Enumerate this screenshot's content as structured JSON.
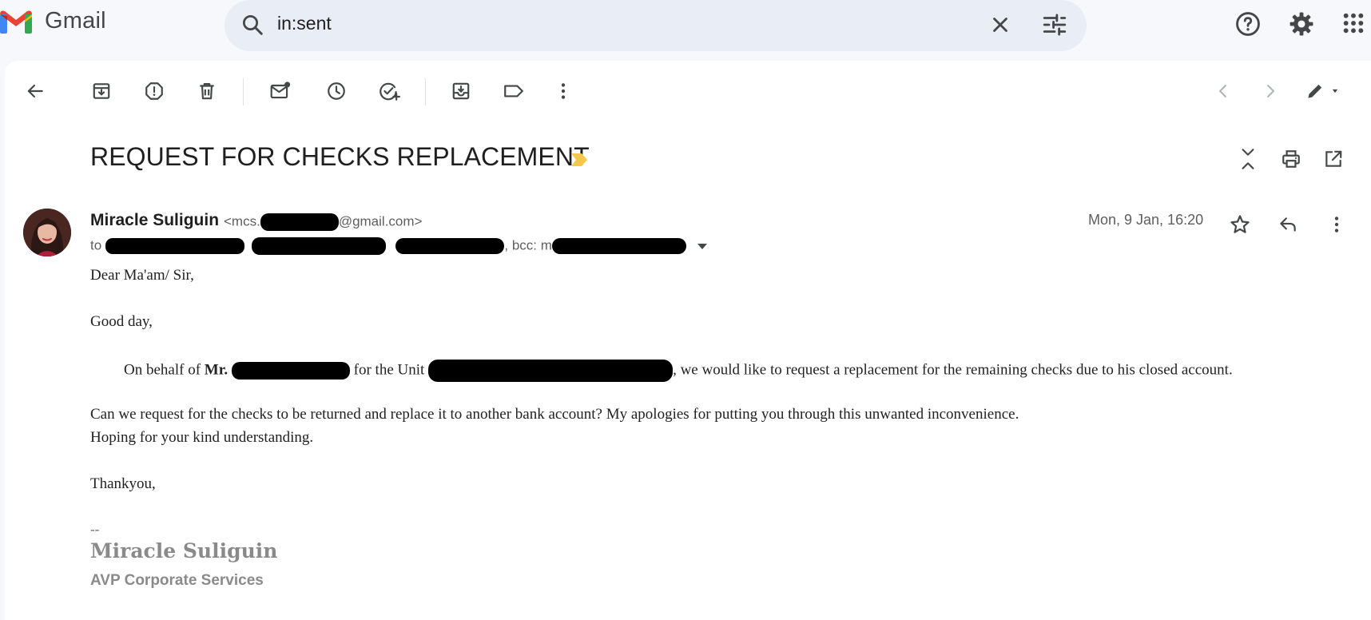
{
  "app": {
    "name": "Gmail"
  },
  "search": {
    "query": "in:sent"
  },
  "toolbar": {
    "icons": [
      "back-arrow-icon",
      "archive-icon",
      "report-spam-icon",
      "delete-icon",
      "mark-unread-icon",
      "snooze-icon",
      "add-to-tasks-icon",
      "move-to-icon",
      "label-icon",
      "more-vert-icon",
      "older-chevron-icon",
      "newer-chevron-icon",
      "pen-icon"
    ]
  },
  "email": {
    "subject": "REQUEST FOR CHECKS REPLACEMENT",
    "sender_name": "Miracle Suliguin",
    "sender_email_prefix": "<mcs.",
    "sender_email_suffix": "@gmail.com>",
    "to_prefix": "to",
    "bcc_label": ", bcc: m",
    "date": "Mon, 9 Jan, 16:20",
    "body": {
      "greeting": "Dear Ma'am/ Sir,",
      "good_day": "Good day,",
      "p1_start": "On behalf of ",
      "p1_mr": "Mr.",
      "p1_mid": " for the Unit ",
      "p1_end": ", we would like to request a replacement for the remaining checks due to his closed account.",
      "p2": "Can we request for the checks to be returned and replace it to another bank account? My apologies for putting you through this unwanted inconvenience.",
      "p3": "Hoping for your kind understanding.",
      "closing": "Thankyou,",
      "sig_sep": "--",
      "sig_name": "Miracle Suliguin",
      "sig_title": "AVP Corporate Services"
    }
  },
  "colors": {
    "background": "#f6f8fc",
    "search_bg": "#e9eef6",
    "important_marker": "#f2c94c",
    "icon_gray": "#444746"
  }
}
